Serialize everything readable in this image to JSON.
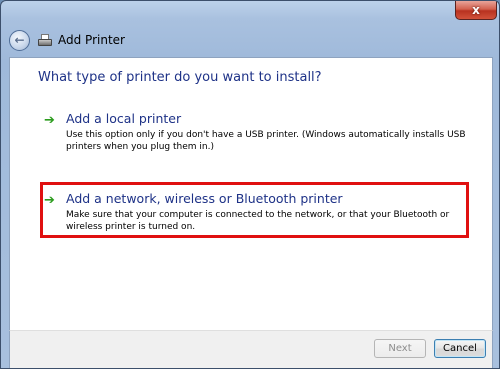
{
  "window": {
    "close_glyph": "x"
  },
  "header": {
    "back_icon": "back-arrow-icon",
    "printer_icon": "printer-icon",
    "title": "Add Printer"
  },
  "main": {
    "question": "What type of printer do you want to install?",
    "options": [
      {
        "icon": "green-arrow-icon",
        "title": "Add a local printer",
        "description": "Use this option only if you don't have a USB printer. (Windows automatically installs USB printers when you plug them in.)"
      },
      {
        "icon": "green-arrow-icon",
        "title": "Add a network, wireless or Bluetooth printer",
        "description": "Make sure that your computer is connected to the network, or that your Bluetooth or wireless printer is turned on.",
        "highlighted": true
      }
    ],
    "highlight_color": "#e01010"
  },
  "footer": {
    "next_label": "Next",
    "next_enabled": false,
    "cancel_label": "Cancel"
  },
  "colors": {
    "heading_blue": "#1e3287",
    "arrow_green": "#2c9c1e",
    "close_red": "#c8412d"
  }
}
